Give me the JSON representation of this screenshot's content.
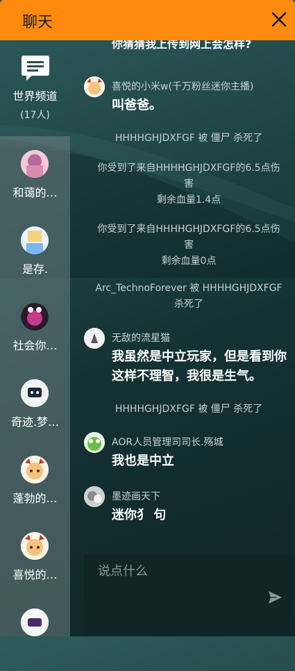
{
  "header": {
    "title": "聊天"
  },
  "world_channel": {
    "label": "世界频道",
    "count": "(17人)"
  },
  "contacts": [
    {
      "name": "和蔼的…"
    },
    {
      "name": "是存."
    },
    {
      "name": "社会你…"
    },
    {
      "name": "奇迹.梦…"
    },
    {
      "name": "蓬勃的…"
    },
    {
      "name": "喜悦的…"
    },
    {
      "name": ""
    }
  ],
  "messages": {
    "cut_top": "你猜猜我上传到网上会怎样?",
    "m1": {
      "name": "喜悦的小米w(千万粉丝迷你主播)",
      "text": "叫爸爸。"
    },
    "s1": "HHHHGHJDXFGF 被 僵尸 杀死了",
    "s2_line1": "你受到了来自HHHHGHJDXFGF的6.5点伤",
    "s2_line2": "害",
    "s2_line3": "剩余血量1.4点",
    "s3_line1": "你受到了来自HHHHGHJDXFGF的6.5点伤",
    "s3_line2": "害",
    "s3_line3": "剩余血量0点",
    "s4_line1": "Arc_TechnoForever 被 HHHHGHJDXFGF",
    "s4_line2": "杀死了",
    "m2": {
      "name": "无敌的流星猫",
      "text": "我虽然是中立玩家，但是看到你这样不理智，我很是生气。"
    },
    "s5": "HHHHGHJDXFGF 被 僵尸 杀死了",
    "m3": {
      "name": "AOR人员管理司司长.殇城",
      "text": "我也是中立"
    },
    "m4": {
      "name": "墨迹画天下",
      "text": "迷你犭 句"
    }
  },
  "input": {
    "placeholder": "说点什么"
  },
  "colors": {
    "header": "#ff8a0d",
    "background": "#1a3a3c"
  }
}
